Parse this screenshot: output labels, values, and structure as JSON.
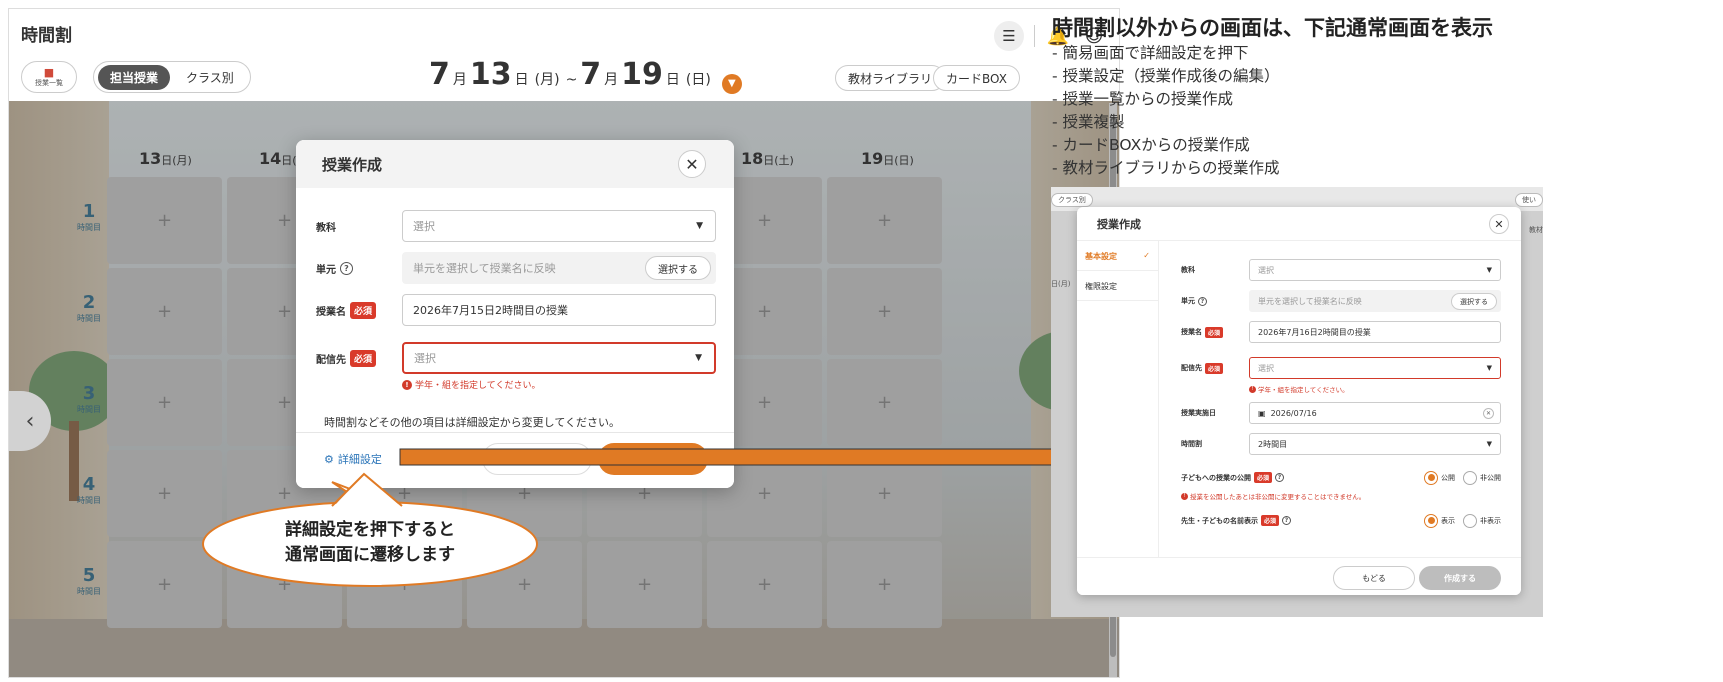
{
  "left": {
    "app_title": "時間割",
    "lesson_list_label": "授業一覧",
    "view_tabs": [
      "担当授業",
      "クラス別"
    ],
    "week": {
      "m1": "7",
      "d1": "13",
      "w1": "(月)",
      "sep": "~",
      "m2": "7",
      "d2": "19",
      "w2": "(日)",
      "month_unit": "月",
      "day_unit": "日"
    },
    "material_library": "教材ライブラリ",
    "card_box": "カードBOX",
    "days": [
      {
        "num": "13",
        "label": "日(月)"
      },
      {
        "num": "14",
        "label": "日("
      },
      {
        "num": "18",
        "label": "日(土)"
      },
      {
        "num": "19",
        "label": "日(日)"
      }
    ],
    "periods": [
      "1",
      "2",
      "3",
      "4",
      "5"
    ],
    "period_unit": "時間目",
    "plus": "+"
  },
  "modal": {
    "title": "授業作成",
    "close": "✕",
    "subject_label": "教科",
    "subject_placeholder": "選択",
    "unit_label": "単元",
    "unit_placeholder": "単元を選択して授業名に反映",
    "unit_button": "選択する",
    "lesson_name_label": "授業名",
    "required": "必須",
    "lesson_name_value": "2026年7月15日2時間目の授業",
    "delivery_label": "配信先",
    "delivery_placeholder": "選択",
    "delivery_error": "学年・組を指定してください。",
    "note": "時間割などその他の項目は詳細設定から変更してください。",
    "advanced_link": "詳細設定"
  },
  "bubble": {
    "line1": "詳細設定を押下すると",
    "line2": "通常画面に遷移します"
  },
  "annotation": {
    "heading": "時間割以外からの画面は、下記通常画面を表示",
    "bullets": [
      "- 簡易画面で詳細設定を押下",
      "- 授業設定（授業作成後の編集）",
      "- 授業一覧からの授業作成",
      "- 授業複製",
      "- カードBOXからの授業作成",
      "- 教材ライブラリからの授業作成"
    ]
  },
  "right": {
    "title": "授業作成",
    "close": "✕",
    "side_items": [
      "基本設定",
      "権限設定"
    ],
    "bg_chips": [
      "クラス別",
      "使い",
      "教材"
    ],
    "bg_left_tab": "日(月)",
    "subject_label": "教科",
    "subject_placeholder": "選択",
    "unit_label": "単元",
    "unit_placeholder": "単元を選択して授業名に反映",
    "unit_button": "選択する",
    "lesson_name_label": "授業名",
    "required": "必須",
    "lesson_name_value": "2026年7月16日2時間目の授業",
    "delivery_label": "配信先",
    "delivery_placeholder": "選択",
    "delivery_error": "学年・組を指定してください。",
    "date_label": "授業実施日",
    "date_value": "2026/07/16",
    "period_label": "時間割",
    "period_value": "2時間目",
    "publish_label": "子どもへの授業の公開",
    "publish_options": [
      "公開",
      "非公開"
    ],
    "publish_note": "授業を公開したあとは非公開に変更することはできません。",
    "names_label": "先生・子どもの名前表示",
    "names_options": [
      "表示",
      "非表示"
    ],
    "back_button": "もどる",
    "create_button": "作成する"
  },
  "colors": {
    "accent": "#e07a24",
    "error": "#d23a2a",
    "link": "#2a74b8"
  }
}
